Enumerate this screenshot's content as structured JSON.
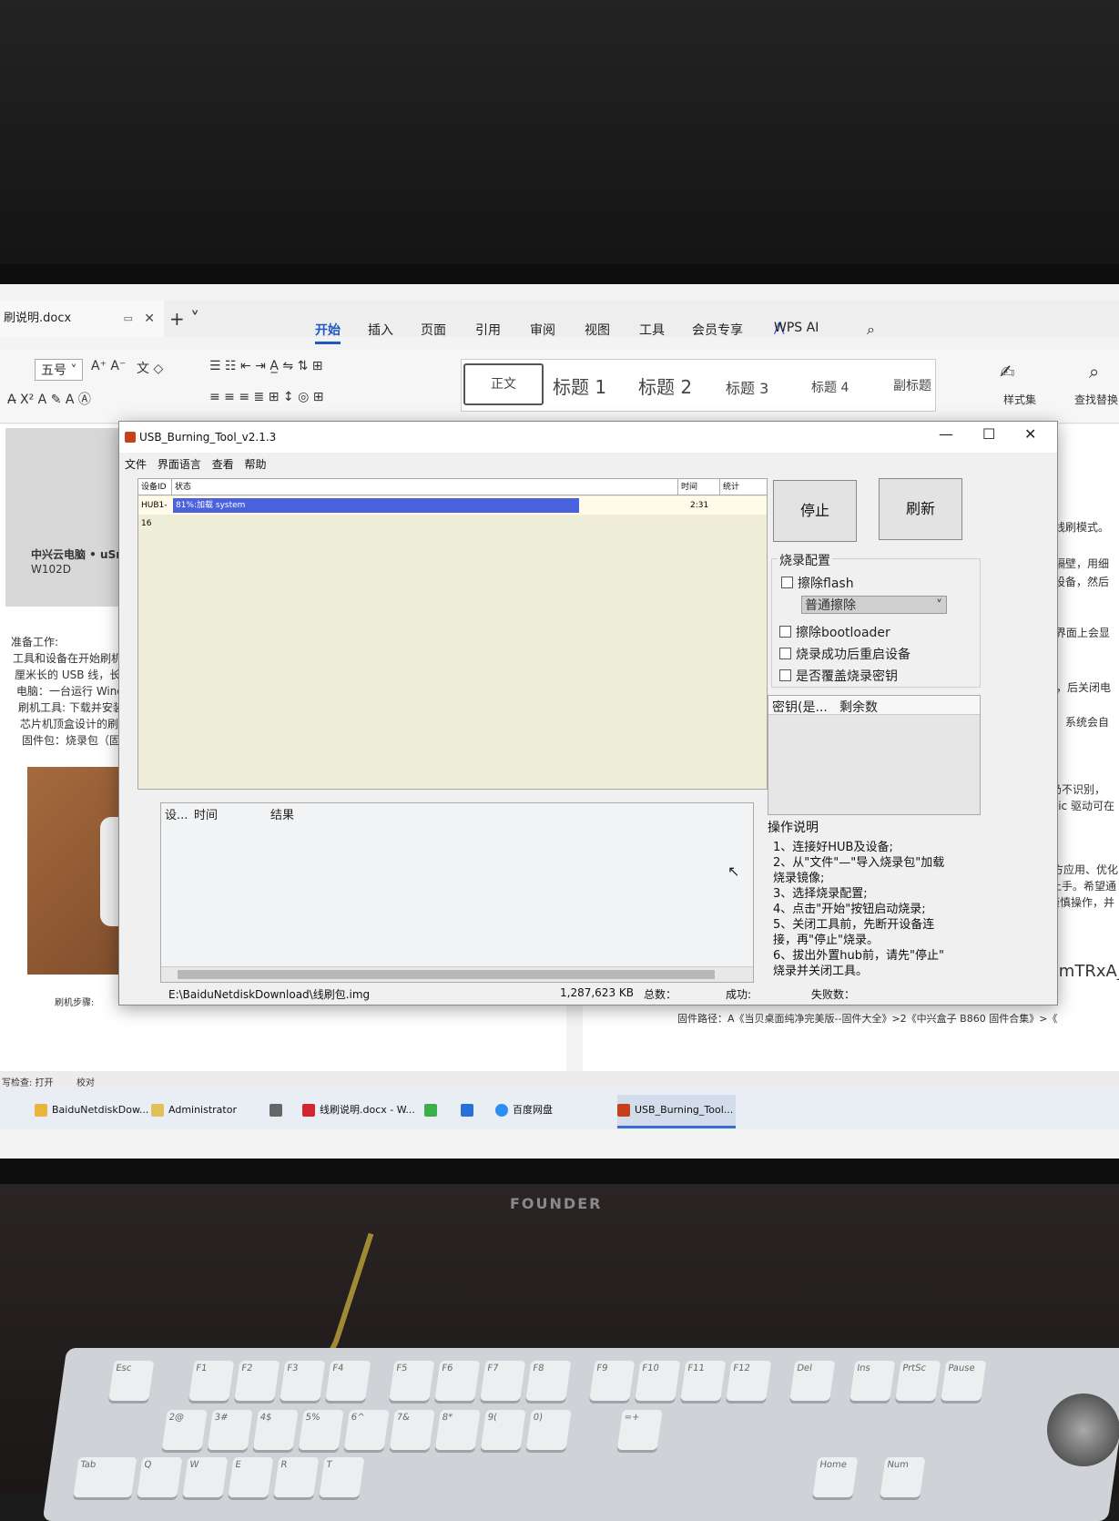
{
  "wps": {
    "doc_tab": "刷说明.docx",
    "menu": [
      "开始",
      "插入",
      "页面",
      "引用",
      "审阅",
      "视图",
      "工具",
      "会员专享",
      "WPS AI"
    ],
    "font_size": "五号",
    "styles": [
      "正文",
      "标题 1",
      "标题 2",
      "标题 3",
      "标题 4",
      "副标题"
    ],
    "style_set": "样式集",
    "find_replace": "查找替换",
    "doc_left": {
      "photo_caption_1": "中兴云电脑 • uSmart",
      "photo_caption_2": "W102D",
      "lines": [
        "准备工作:",
        "工具和设备在开始刷机之前",
        "厘米长的 USB 线，长度适中",
        "电脑：一台运行 Windows 系",
        "刷机工具: 下载并安装 Amlo",
        "芯片机顶盒设计的刷机软件",
        "固件包：烧录包（固件文件"
      ],
      "steps": "刷机步骤:"
    },
    "doc_right": {
      "lines": [
        "入线刷模式。",
        "线隔壁，用细",
        "现设备，然后",
        "F。界面上会显",
        "软件，后关闭电",
        "分钟，系统会自",
        "如果仍不识别，",
        "Amlogic 驱动可在",
        "装第三方应用、优化",
        "能轻松上手。希望通",
        "效，请谨慎操作，并"
      ],
      "code": "UvHpmTRxA_",
      "firmware_path": "固件路径：A《当贝桌面纯净完美版--固件大全》>2《中兴盒子 B860 固件合集》>《"
    },
    "statusbar": [
      "写检查: 打开",
      "校对"
    ]
  },
  "taskbar": {
    "items": [
      "BaiduNetdiskDow...",
      "Administrator",
      "线刷说明.docx - W...",
      "百度网盘",
      "USB_Burning_Tool..."
    ]
  },
  "usb_tool": {
    "title": "USB_Burning_Tool_v2.1.3",
    "menu": [
      "文件",
      "界面语言",
      "查看",
      "帮助"
    ],
    "list_headers": {
      "device_id": "设备ID",
      "status": "状态",
      "time": "时间",
      "stats": "统计"
    },
    "device": {
      "id": "HUB1-16",
      "status": "81%:加载 system",
      "time": "2:31",
      "progress": 0.81
    },
    "result_headers": [
      "设...",
      "时间",
      "结果"
    ],
    "buttons": {
      "stop": "停止",
      "refresh": "刷新"
    },
    "config": {
      "label": "烧录配置",
      "erase_flash": "擦除flash",
      "erase_mode": "普通擦除",
      "erase_bootloader": "擦除bootloader",
      "reboot_after": "烧录成功后重启设备",
      "overwrite_key": "是否覆盖烧录密钥"
    },
    "key_headers": [
      "密钥(是...",
      "剩余数"
    ],
    "instructions": {
      "label": "操作说明",
      "lines": [
        "1、连接好HUB及设备;",
        "2、从\"文件\"—\"导入烧录包\"加载",
        "烧录镜像;",
        "3、选择烧录配置;",
        "4、点击\"开始\"按钮启动烧录;",
        "5、关闭工具前，先断开设备连",
        "接，再\"停止\"烧录。",
        "6、拔出外置hub前，请先\"停止\"",
        "烧录并关闭工具。"
      ]
    },
    "status": {
      "path": "E:\\BaiduNetdiskDownload\\线刷包.img",
      "size": "1,287,623 KB",
      "total": "总数：",
      "success": "成功:",
      "fail": "失败数："
    }
  },
  "monitor_brand": "FOUNDER",
  "keyboard_keys": [
    "Esc",
    "F1",
    "F2",
    "F3",
    "F4",
    "F5",
    "F6",
    "F7",
    "F8",
    "F9",
    "F10",
    "F11",
    "F12",
    "Del",
    "Ins",
    "PrtSc",
    "Pause",
    "2@",
    "3#",
    "4$",
    "5%",
    "6^",
    "7&",
    "8*",
    "9(",
    "0)",
    "=+",
    "Tab",
    "Q",
    "W",
    "E",
    "R",
    "T",
    "Home",
    "Num"
  ]
}
